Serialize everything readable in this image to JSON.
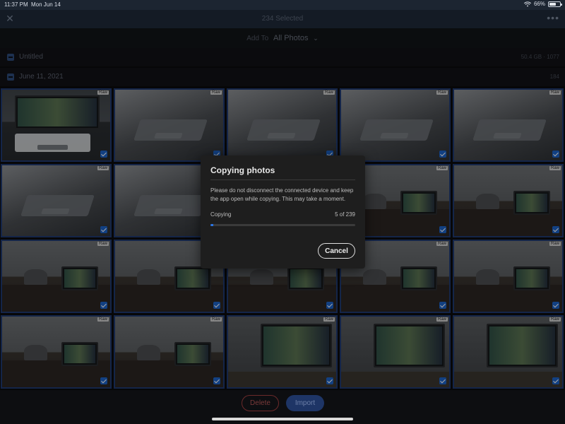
{
  "status_bar": {
    "time": "11:37 PM",
    "date": "Mon Jun 14",
    "battery": "66%",
    "battery_level": 0.66,
    "icons": [
      "wifi-icon",
      "battery-icon"
    ]
  },
  "top_bar": {
    "title": "234 Selected",
    "close_icon": "close-icon",
    "more_icon": "more-icon"
  },
  "add_to": {
    "label": "Add To",
    "value": "All Photos"
  },
  "sections": [
    {
      "name": "Untitled",
      "meta": "50.4 GB · 1077"
    },
    {
      "name": "June 11, 2021",
      "meta": "184"
    }
  ],
  "tile_badge": "Raw",
  "dialog": {
    "title": "Copying photos",
    "message": "Please do not disconnect the connected device and keep the app open while copying. This may take a moment.",
    "progress_label": "Copying",
    "progress_count": "5 of 239",
    "progress_fraction": 0.021,
    "cancel_label": "Cancel"
  },
  "bottom_bar": {
    "delete_label": "Delete",
    "import_label": "Import"
  },
  "colors": {
    "accent": "#2c74e0",
    "selection_border": "#1f3a70",
    "top_bar": "#1f2a3a"
  }
}
